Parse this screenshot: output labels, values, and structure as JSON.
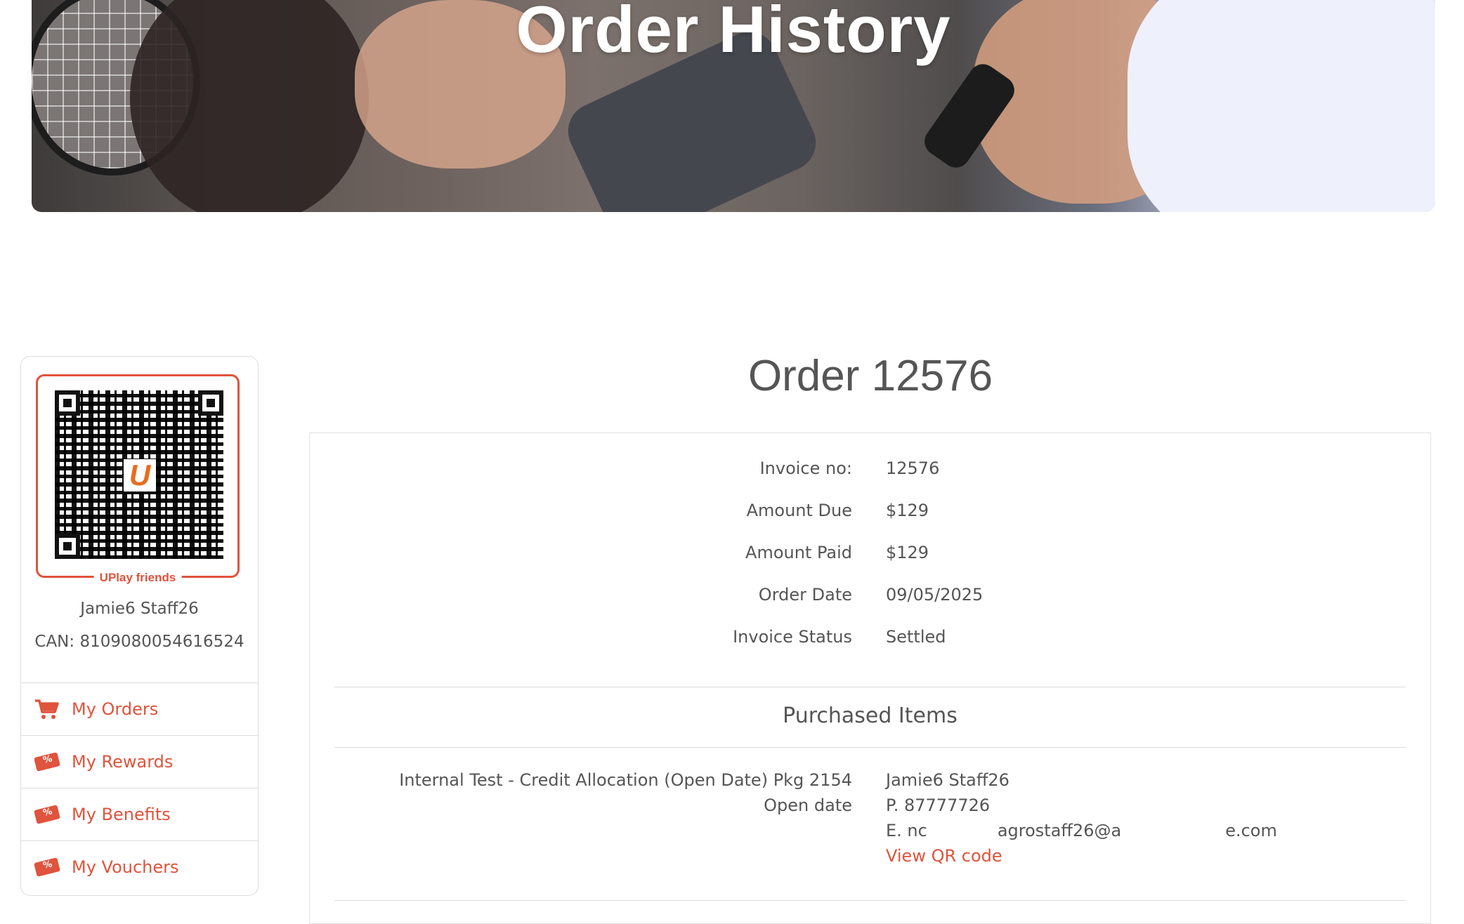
{
  "hero": {
    "title": "Order History"
  },
  "sidebar": {
    "qr_caption": "UPlay friends",
    "qr_logo_letter": "U",
    "user_name": "Jamie6 Staff26",
    "can": "CAN: 8109080054616524",
    "nav": [
      {
        "label": "My Orders",
        "icon": "cart-icon"
      },
      {
        "label": "My Rewards",
        "icon": "ticket-icon"
      },
      {
        "label": "My Benefits",
        "icon": "ticket-icon"
      },
      {
        "label": "My Vouchers",
        "icon": "ticket-icon"
      }
    ]
  },
  "order": {
    "title": "Order 12576",
    "details": [
      {
        "label": "Invoice no:",
        "value": "12576"
      },
      {
        "label": "Amount Due",
        "value": "$129"
      },
      {
        "label": "Amount Paid",
        "value": "$129"
      },
      {
        "label": "Order Date",
        "value": "09/05/2025"
      },
      {
        "label": "Invoice Status",
        "value": "Settled"
      }
    ],
    "purchased_title": "Purchased Items",
    "items": [
      {
        "description": "Internal Test - Credit Allocation (Open Date) Pkg 2154",
        "date_note": "Open date",
        "holder_name": "Jamie6 Staff26",
        "phone": "P. 87777726",
        "email_start": "E. nc",
        "email_middle": "agrostaff26@a",
        "email_end": "e.com",
        "qr_link": "View QR code"
      }
    ]
  },
  "colors": {
    "accent": "#e0533c",
    "text": "#555555",
    "border": "#dddddd"
  }
}
